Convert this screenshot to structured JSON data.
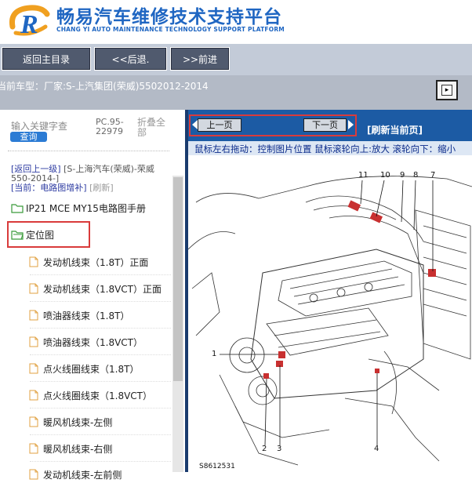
{
  "header": {
    "title": "畅易汽车维修技术支持平台",
    "subtitle": "CHANG YI AUTO MAINTENANCE TECHNOLOGY SUPPORT PLATFORM"
  },
  "nav": {
    "home": "返回主目录",
    "back": "<<后退.",
    "forward": ">>前进"
  },
  "vehicle": {
    "label": "当前车型：",
    "value": "厂家:S-上汽集团(荣威)5502012-2014"
  },
  "sidebar": {
    "search_label": "输入关键字查",
    "search_button": "查询",
    "pc_code": "PC.95-22979",
    "collapse_all": "折叠全部",
    "up_link": "[返回上一级]",
    "up_path": "[S-上海汽车(荣威)-荣威550-2014-]",
    "current_label": "[当前：电路图增补]",
    "refresh": "[刷新]",
    "folders": [
      {
        "label": "IP21 MCE MY15电路图手册"
      },
      {
        "label": "定位图"
      }
    ],
    "items": [
      {
        "label": "发动机线束（1.8T）正面"
      },
      {
        "label": "发动机线束（1.8VCT）正面"
      },
      {
        "label": "喷油器线束（1.8T）"
      },
      {
        "label": "喷油器线束（1.8VCT）"
      },
      {
        "label": "点火线圈线束（1.8T）"
      },
      {
        "label": "点火线圈线束（1.8VCT）"
      },
      {
        "label": "暖风机线束-左侧"
      },
      {
        "label": "暖风机线束-右侧"
      },
      {
        "label": "发动机线束-左前侧"
      }
    ]
  },
  "viewer": {
    "prev_page": "上一页",
    "next_page": "下一页",
    "refresh_page": "[刷新当前页]",
    "hint": "鼠标左右拖动：控制图片位置  鼠标滚轮向上:放大  滚轮向下：缩小",
    "figure_code": "S8612531",
    "callouts": [
      "11",
      "10",
      "9",
      "8",
      "7",
      "1",
      "2",
      "3",
      "4"
    ]
  },
  "colors": {
    "brand_blue": "#1f66c2",
    "nav_button": "#505a6e",
    "viewer_bar": "#1c5ba4",
    "highlight_red": "#d93b3b"
  }
}
